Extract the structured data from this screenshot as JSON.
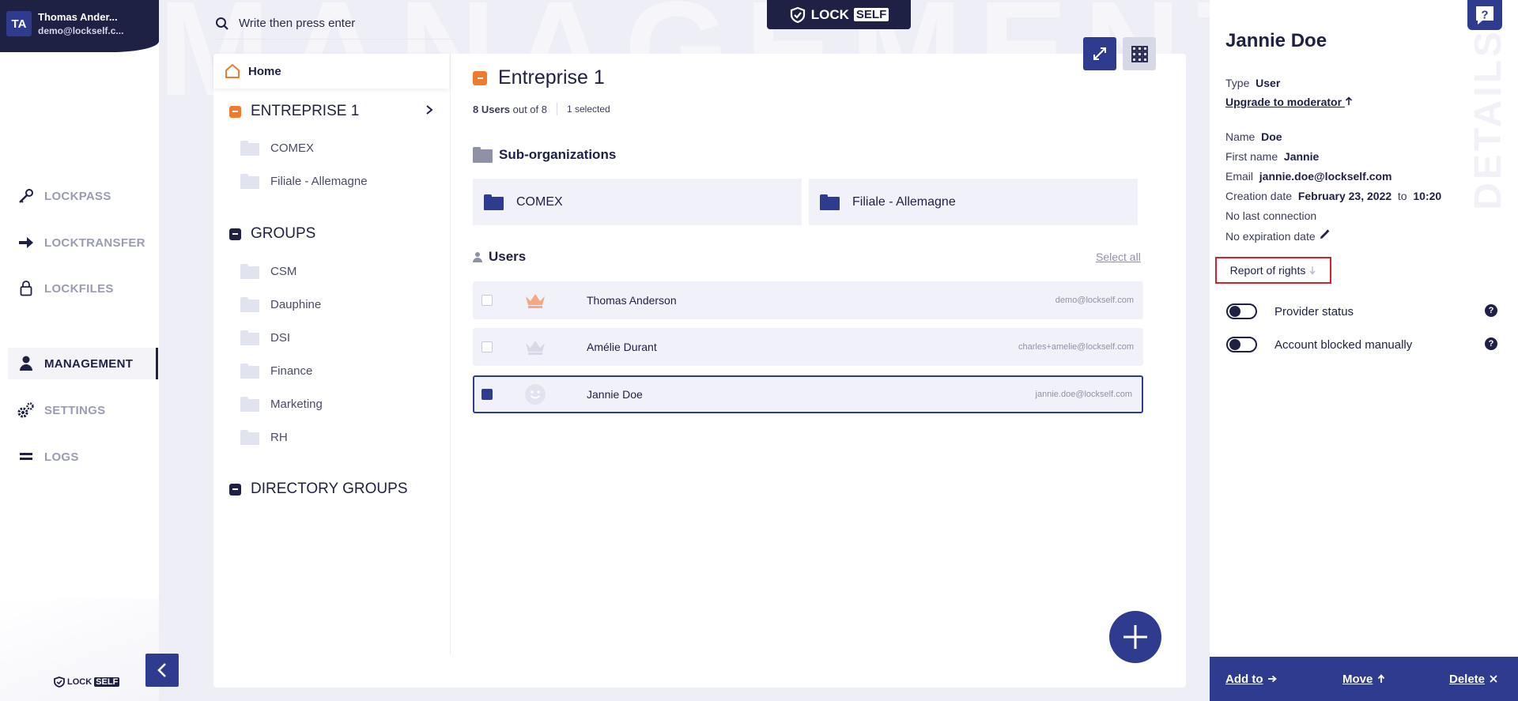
{
  "user": {
    "initials": "TA",
    "name": "Thomas Ander...",
    "email": "demo@lockself.c..."
  },
  "nav": {
    "items": [
      {
        "label": "LOCKPASS",
        "icon": "key-icon",
        "active": false
      },
      {
        "label": "LOCKTRANSFER",
        "icon": "arrow-right-icon",
        "active": false
      },
      {
        "label": "LOCKFILES",
        "icon": "lock-icon",
        "active": false
      },
      {
        "label": "MANAGEMENT",
        "icon": "person-icon",
        "active": true
      },
      {
        "label": "SETTINGS",
        "icon": "gears-icon",
        "active": false
      },
      {
        "label": "LOGS",
        "icon": "bars-icon",
        "active": false
      }
    ]
  },
  "brand": {
    "lock": "LOCK",
    "self": "SELF"
  },
  "watermark": "MANAGEMENT",
  "search": {
    "placeholder": "Write then press enter"
  },
  "tree": {
    "home_label": "Home",
    "enterprise": {
      "label": "ENTREPRISE 1",
      "children": [
        "COMEX",
        "Filiale - Allemagne"
      ]
    },
    "groups": {
      "label": "GROUPS",
      "children": [
        "CSM",
        "Dauphine",
        "DSI",
        "Finance",
        "Marketing",
        "RH"
      ]
    },
    "directory_groups": {
      "label": "DIRECTORY GROUPS"
    }
  },
  "content": {
    "title": "Entreprise 1",
    "users_count": "8 Users",
    "users_total": "out of 8",
    "selected": "1 selected",
    "suborg_title": "Sub-organizations",
    "suborgs": [
      "COMEX",
      "Filiale - Allemagne"
    ],
    "users_title": "Users",
    "select_all": "Select all",
    "users": [
      {
        "name": "Thomas Anderson",
        "email": "demo@lockself.com",
        "role": "admin",
        "selected": false
      },
      {
        "name": "Amélie Durant",
        "email": "charles+amelie@lockself.com",
        "role": "moderator",
        "selected": false
      },
      {
        "name": "Jannie Doe",
        "email": "jannie.doe@lockself.com",
        "role": "user",
        "selected": true
      }
    ]
  },
  "details": {
    "vertical_label": "DETAILS",
    "name": "Jannie Doe",
    "type_label": "Type",
    "type_value": "User",
    "upgrade_link": "Upgrade to moderator",
    "name_label": "Name",
    "name_value": "Doe",
    "first_name_label": "First name",
    "first_name_value": "Jannie",
    "email_label": "Email",
    "email_value": "jannie.doe@lockself.com",
    "creation_label": "Creation date",
    "creation_date": "February 23, 2022",
    "creation_to": "to",
    "creation_time": "10:20",
    "last_connection": "No last connection",
    "expiration": "No expiration date",
    "report_button": "Report of rights",
    "toggles": [
      {
        "label": "Provider status",
        "on": false
      },
      {
        "label": "Account blocked manually",
        "on": false
      }
    ],
    "actions": {
      "add_to": "Add to",
      "move": "Move",
      "delete": "Delete"
    }
  },
  "colors": {
    "navy": "#1e2044",
    "primary": "#2e3b8f",
    "accent": "#f07b2e",
    "highlight": "#d9202a",
    "row_bg": "#f1f2f9"
  }
}
